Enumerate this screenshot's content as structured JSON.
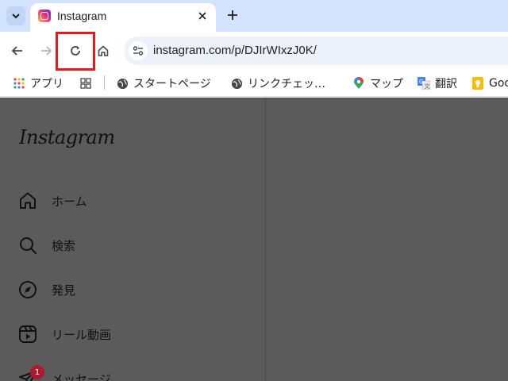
{
  "browser": {
    "tab": {
      "title": "Instagram"
    },
    "address_bar": {
      "url": "instagram.com/p/DJIrWIxzJ0K/"
    },
    "bookmarks": [
      {
        "label": "アプリ",
        "icon": "apps-grid-icon"
      },
      {
        "label": "",
        "icon": "grid-icon"
      },
      {
        "label": "スタートページ",
        "icon": "globe-icon"
      },
      {
        "label": "リンクチェッ…",
        "icon": "globe-icon"
      },
      {
        "label": "マップ",
        "icon": "maps-pin-icon"
      },
      {
        "label": "翻訳",
        "icon": "translate-icon"
      },
      {
        "label": "Goo",
        "icon": "keep-icon"
      }
    ]
  },
  "instagram": {
    "logo": "Instagram",
    "nav": [
      {
        "label": "ホーム",
        "icon": "home-icon"
      },
      {
        "label": "検索",
        "icon": "search-icon"
      },
      {
        "label": "発見",
        "icon": "explore-compass-icon"
      },
      {
        "label": "リール動画",
        "icon": "reels-icon"
      },
      {
        "label": "メッセージ",
        "icon": "messenger-icon",
        "badge": "1"
      }
    ]
  },
  "colors": {
    "tabstrip": "#d3e3fd",
    "highlight": "#e5191b",
    "page_overlay": "#5b5b5b",
    "badge": "#ad1a2e"
  }
}
